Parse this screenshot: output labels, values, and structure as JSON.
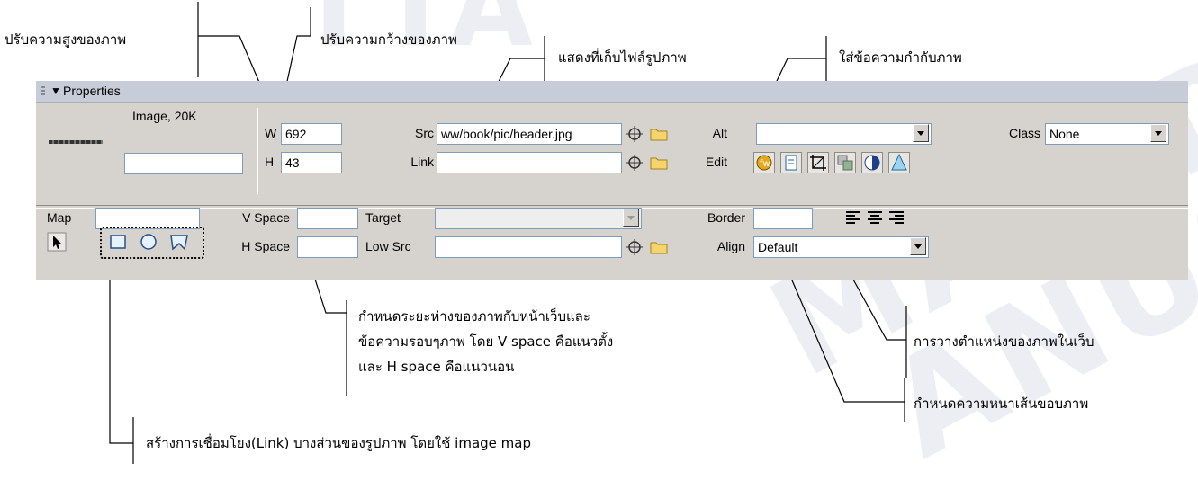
{
  "callouts": {
    "height": "ปรับความสูงของภาพ",
    "width": "ปรับความกว้างของภาพ",
    "src": "แสดงที่เก็บไฟล์รูปภาพ",
    "alt": "ใส่ข้อความกำกับภาพ",
    "space_lines": [
      "กำหนดระยะห่างของภาพกับหน้าเว็บและ",
      "ข้อความรอบๆภาพ โดย V space คือแนวตั้ง",
      "และ H space คือแนวนอน"
    ],
    "align": "การวางตำแหน่งของภาพในเว็บ",
    "border": "กำหนดความหนาเส้นขอบภาพ",
    "map": "สร้างการเชื่อมโยง(Link) บางส่วนของรูปภาพ โดยใช้ image map"
  },
  "watermarks": [
    "TTA",
    "MAHID",
    "ANUS"
  ],
  "panel": {
    "title": "Properties",
    "image_info": "Image, 20K",
    "image_name": "",
    "w_label": "W",
    "w_value": "692",
    "h_label": "H",
    "h_value": "43",
    "src_label": "Src",
    "src_value": "ww/book/pic/header.jpg",
    "link_label": "Link",
    "link_value": "",
    "alt_label": "Alt",
    "alt_value": "",
    "edit_label": "Edit",
    "class_label": "Class",
    "class_value": "None",
    "map_label": "Map",
    "map_value": "",
    "vspace_label": "V Space",
    "vspace_value": "",
    "hspace_label": "H Space",
    "hspace_value": "",
    "target_label": "Target",
    "target_value": "",
    "lowsrc_label": "Low Src",
    "lowsrc_value": "",
    "border_label": "Border",
    "border_value": "",
    "align_label": "Align",
    "align_value": "Default"
  }
}
